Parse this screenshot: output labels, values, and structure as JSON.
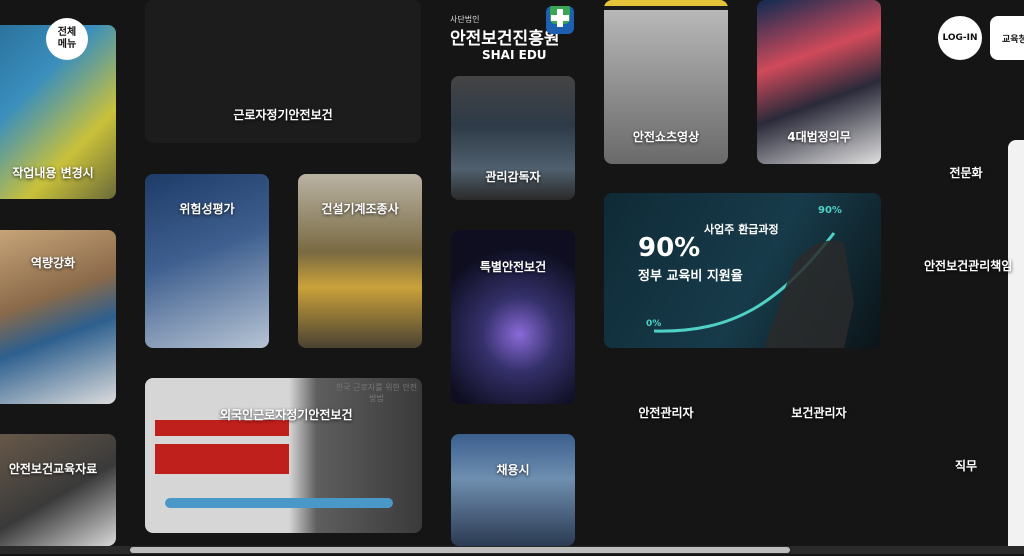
{
  "header": {
    "menu_label": "전체\n메뉴",
    "logo_small": "사단법인",
    "logo_main": "안전보건진흥원",
    "logo_sub": "SHAI EDU",
    "login_label": "LOG-IN",
    "edu_label": "교육청"
  },
  "tiles": {
    "work_change": "작업내용 변경시",
    "capacity": "역량강화",
    "safety_materials": "안전보건교육자료",
    "regular_worker": "근로자정기안전보건",
    "risk_assessment": "위험성평가",
    "construction_machine": "건설기계조종사",
    "foreign_worker": "외국인근로자정기안전보건",
    "supervisor": "관리감독자",
    "special_safety": "특별안전보건",
    "hiring": "채용시",
    "safety_short_video": "안전쇼츠영상",
    "four_laws": "4대법정의무",
    "safety_manager": "안전관리자",
    "health_manager": "보건관리자",
    "specialization": "전문화",
    "safety_health_officer": "안전보건관리책임",
    "job": "직무"
  },
  "promo": {
    "title": "사업주 환급과정",
    "big_number": "90%",
    "subtitle": "정부 교육비 지원율",
    "curve_start": "0%",
    "curve_end": "90%"
  },
  "foreign_slide": {
    "heading": "한국 근로자를 위한 안전 방법"
  },
  "colors": {
    "background": "#151515",
    "accent_red": "#c0201c",
    "curve": "#4fd1c5",
    "logo_blue": "#1d5fb0",
    "logo_green": "#3aa651"
  }
}
